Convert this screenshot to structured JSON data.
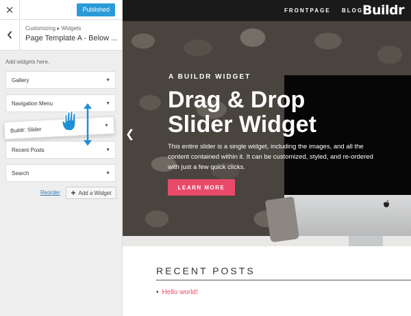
{
  "customizer": {
    "close_icon": "close-icon",
    "publish_label": "Published",
    "breadcrumb": "Customizing ▸ Widgets",
    "section_title": "Page Template A - Below ...",
    "hint": "Add widgets here.",
    "widgets": [
      {
        "label": "Gallery"
      },
      {
        "label": "Navigation Menu"
      },
      {
        "label": "Buildr: Slider"
      },
      {
        "label": "Recent Posts"
      },
      {
        "label": "Search"
      }
    ],
    "reorder_label": "Reorder",
    "add_widget_label": "Add a Widget",
    "accent_color": "#2a9bd8"
  },
  "site": {
    "nav": [
      "FRONTPAGE",
      "BLOG"
    ],
    "logo": "Buildr",
    "hero": {
      "eyebrow": "A BUILDR WIDGET",
      "title": "Drag & Drop Slider Widget",
      "body": "This entire slider is a single widget, including the images, and all the content contained within it. It can be customized, styled, and re-ordered with just a few quick clicks.",
      "cta": "LEARN MORE",
      "cta_color": "#e84a6a"
    },
    "recent_posts": {
      "title": "RECENT POSTS",
      "items": [
        "Hello world!"
      ]
    }
  }
}
